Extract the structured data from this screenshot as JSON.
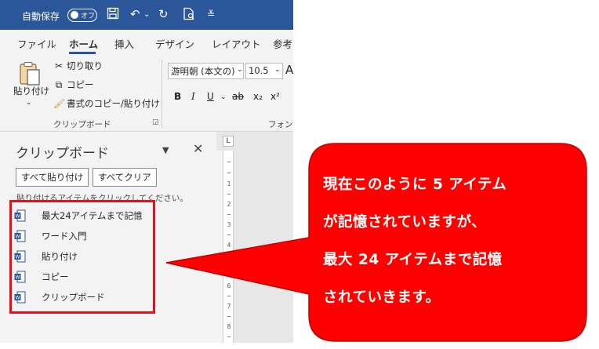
{
  "titlebar": {
    "autosave_label": "自動保存",
    "autosave_state": "オフ"
  },
  "ribbon_tabs": [
    "ファイル",
    "ホーム",
    "挿入",
    "デザイン",
    "レイアウト",
    "参考"
  ],
  "ribbon": {
    "paste_label": "貼り付け",
    "cut_label": "切り取り",
    "copy_label": "コピー",
    "format_painter_label": "書式のコピー/貼り付け",
    "clipboard_group_label": "クリップボード",
    "font_name": "游明朝 (本文の)",
    "font_size": "10.5",
    "font_group_label": "フォント",
    "bold": "B",
    "italic": "I",
    "underline": "U",
    "strike": "ab",
    "subscript": "x₂",
    "superscript": "x²"
  },
  "clipboard_pane": {
    "title": "クリップボード",
    "paste_all_label": "すべて貼り付け",
    "clear_all_label": "すべてクリア",
    "hint": "貼り付けるアイテムをクリックしてください。",
    "items": [
      "最大24アイテムまで記憶",
      "ワード入門",
      "貼り付け",
      "コピー",
      "クリップボード"
    ]
  },
  "ruler": {
    "corner": "L",
    "numbers": [
      "1",
      "2",
      "3",
      "4",
      "5",
      "6",
      "7",
      "8"
    ]
  },
  "callout": {
    "lines": [
      "現在このように 5 アイテム",
      "が記憶されていますが、",
      "最大 24 アイテムまで記憶",
      "されていきます。"
    ],
    "fill_color": "#ff0000",
    "stroke_color": "#c00000"
  },
  "colors": {
    "titlebar": "#2b579a",
    "highlight_border": "#e8101a"
  }
}
